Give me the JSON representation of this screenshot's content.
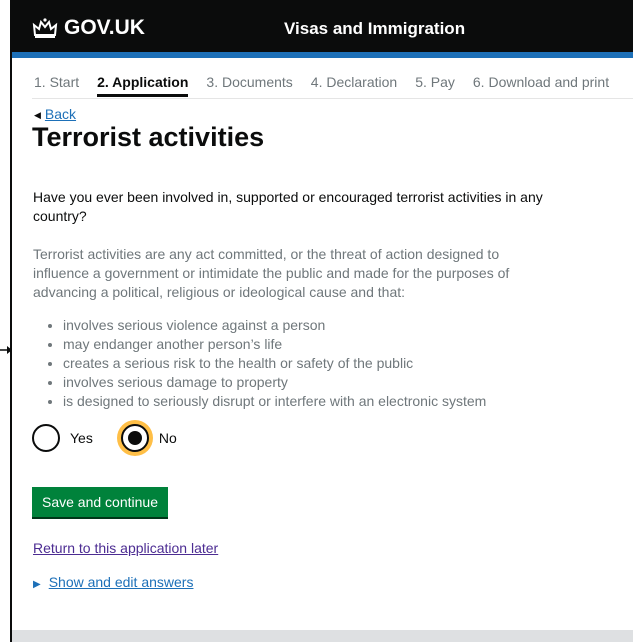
{
  "header": {
    "logo_text": "GOV.UK",
    "logo_icon": "crown-icon",
    "service_name": "Visas and Immigration",
    "stripe_color": "#1d70b8"
  },
  "steps": [
    {
      "label": "1. Start",
      "active": false
    },
    {
      "label": "2. Application",
      "active": true
    },
    {
      "label": "3. Documents",
      "active": false
    },
    {
      "label": "4. Declaration",
      "active": false
    },
    {
      "label": "5. Pay",
      "active": false
    },
    {
      "label": "6. Download and print",
      "active": false
    }
  ],
  "back_link": "Back",
  "page_title": "Terrorist activities",
  "question": "Have you ever been involved in, supported or encouraged terrorist activities in any country?",
  "hint": "Terrorist activities are any act committed, or the threat of action designed to influence a government or intimidate the public and made for the purposes of advancing a political, religious or ideological cause and that:",
  "bullets": [
    "involves serious violence against a person",
    "may endanger another person’s life",
    "creates a serious risk to the health or safety of the public",
    "involves serious damage to property",
    "is designed to seriously disrupt or interfere with an electronic system"
  ],
  "radios": {
    "yes_label": "Yes",
    "no_label": "No",
    "selected": "No",
    "focus_color": "#ffbf47"
  },
  "save_button": "Save and continue",
  "save_button_color": "#00823b",
  "return_link": "Return to this application later",
  "show_answers": "Show and edit answers"
}
